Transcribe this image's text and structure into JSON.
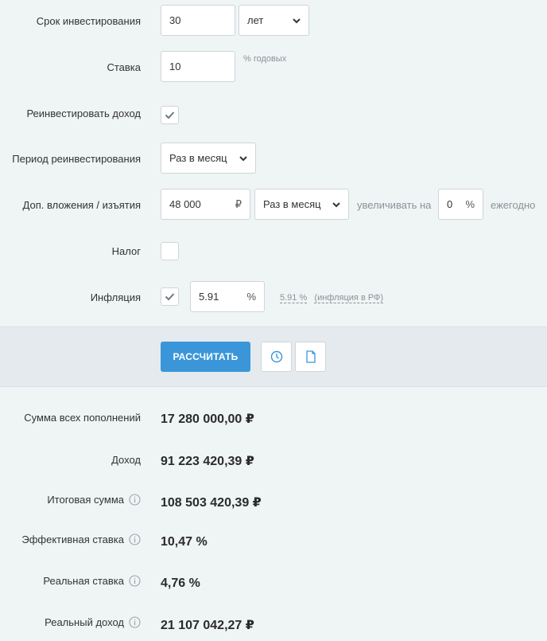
{
  "form": {
    "term": {
      "label": "Срок инвестирования",
      "value": "30",
      "unit": "лет"
    },
    "rate": {
      "label": "Ставка",
      "value": "10",
      "unit": "% годовых"
    },
    "reinvest": {
      "label": "Реинвестировать доход",
      "checked": true
    },
    "reinvest_period": {
      "label": "Период реинвестирования",
      "value": "Раз в месяц"
    },
    "additions": {
      "label": "Доп. вложения / изъятия",
      "amount": "48 000",
      "currency": "₽",
      "period": "Раз в месяц",
      "increase_label": "увеличивать на",
      "increase_value": "0",
      "increase_unit": "%",
      "suffix": "ежегодно"
    },
    "tax": {
      "label": "Налог",
      "checked": false
    },
    "inflation": {
      "label": "Инфляция",
      "checked": true,
      "value": "5.91",
      "unit": "%",
      "hint_value": "5.91 %",
      "hint_text": "(инфляция в РФ)"
    }
  },
  "actions": {
    "calculate_label": "РАССЧИТАТЬ",
    "history_icon": "clock-icon",
    "export_icon": "document-icon"
  },
  "results": [
    {
      "label": "Сумма всех пополнений",
      "value": "17 280 000,00 ₽",
      "info": false
    },
    {
      "label": "Доход",
      "value": "91 223 420,39 ₽",
      "info": false
    },
    {
      "label": "Итоговая сумма",
      "value": "108 503 420,39 ₽",
      "info": true
    },
    {
      "label": "Эффективная ставка",
      "value": "10,47 %",
      "info": true
    },
    {
      "label": "Реальная ставка",
      "value": "4,76 %",
      "info": true
    },
    {
      "label": "Реальный доход",
      "value": "21 107 042,27 ₽",
      "info": true
    }
  ],
  "colors": {
    "accent": "#3a96d9",
    "background": "#eff4f4",
    "band": "#e4eaed"
  }
}
